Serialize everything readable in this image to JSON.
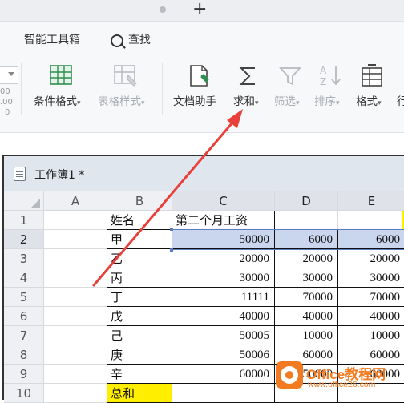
{
  "tabbar": {
    "new_tab": "+"
  },
  "menu": {
    "smart_toolbox": "智能工具箱",
    "search": "查找"
  },
  "ribbon": {
    "left_stub_value": "00",
    "left_stub_value2": ".00",
    "left_stub_value3": "0",
    "tools": [
      {
        "label": "条件格式",
        "icon": "conditional-format-icon",
        "enabled": true,
        "dropdown": true
      },
      {
        "label": "表格样式",
        "icon": "table-style-icon",
        "enabled": false,
        "dropdown": true
      },
      {
        "label": "文档助手",
        "icon": "document-assistant-icon",
        "enabled": true,
        "dropdown": false
      },
      {
        "label": "求和",
        "icon": "sigma-icon",
        "enabled": true,
        "dropdown": true
      },
      {
        "label": "筛选",
        "icon": "filter-icon",
        "enabled": false,
        "dropdown": true
      },
      {
        "label": "排序",
        "icon": "sort-icon",
        "enabled": false,
        "dropdown": true
      },
      {
        "label": "格式",
        "icon": "format-icon",
        "enabled": true,
        "dropdown": true
      },
      {
        "label": "行",
        "icon": "",
        "enabled": true,
        "dropdown": false
      }
    ]
  },
  "workbook": {
    "title": "工作簿1 *",
    "columns": [
      "A",
      "B",
      "C",
      "D",
      "E"
    ],
    "rows": [
      {
        "n": "1",
        "A": "",
        "B": "姓名",
        "C": "第二个月工资",
        "D": "",
        "E": ""
      },
      {
        "n": "2",
        "A": "",
        "B": "甲",
        "C": "50000",
        "D": "6000",
        "E": "6000"
      },
      {
        "n": "3",
        "A": "",
        "B": "乙",
        "C": "20000",
        "D": "20000",
        "E": "20000"
      },
      {
        "n": "4",
        "A": "",
        "B": "丙",
        "C": "30000",
        "D": "30000",
        "E": "30000"
      },
      {
        "n": "5",
        "A": "",
        "B": "丁",
        "C": "11111",
        "D": "70000",
        "E": "70000"
      },
      {
        "n": "6",
        "A": "",
        "B": "戊",
        "C": "40000",
        "D": "40000",
        "E": "40000"
      },
      {
        "n": "7",
        "A": "",
        "B": "己",
        "C": "50005",
        "D": "10000",
        "E": "10000"
      },
      {
        "n": "8",
        "A": "",
        "B": "庚",
        "C": "50006",
        "D": "60000",
        "E": "60000"
      },
      {
        "n": "9",
        "A": "",
        "B": "辛",
        "C": "60000",
        "D": "50000",
        "E": "60000"
      },
      {
        "n": "10",
        "A": "",
        "B": "总和",
        "C": "",
        "D": "",
        "E": ""
      }
    ]
  },
  "watermark": {
    "brand": "Office教程网",
    "url": "www.office26.com"
  },
  "colors": {
    "arrow": "#e8403a",
    "selection": "#c9d6ee",
    "highlight": "#ffee00",
    "watermark": "#f27b21"
  }
}
